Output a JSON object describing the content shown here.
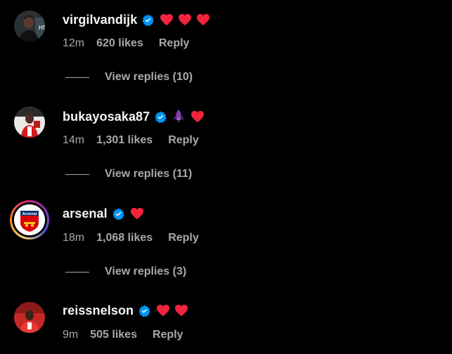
{
  "comments": [
    {
      "username": "virgilvandijk",
      "emoji": [
        "red-heart",
        "red-heart",
        "red-heart"
      ],
      "time": "12m",
      "likes": "620 likes",
      "reply": "Reply",
      "view_replies": "View replies (10)"
    },
    {
      "username": "bukayosaka87",
      "emoji": [
        "purple-rocket",
        "red-heart"
      ],
      "time": "14m",
      "likes": "1,301 likes",
      "reply": "Reply",
      "view_replies": "View replies (11)"
    },
    {
      "username": "arsenal",
      "emoji": [
        "red-heart"
      ],
      "time": "18m",
      "likes": "1,068 likes",
      "reply": "Reply",
      "view_replies": "View replies (3)",
      "avatar_text": "Arsenal"
    },
    {
      "username": "reissnelson",
      "emoji": [
        "red-heart",
        "red-heart"
      ],
      "time": "9m",
      "likes": "505 likes",
      "reply": "Reply"
    }
  ],
  "colors": {
    "background": "#000000",
    "primary_text": "#f5f5f5",
    "secondary_text": "#a8a8a8",
    "verified_blue": "#0095f6",
    "heart_red": "#f0243c"
  }
}
